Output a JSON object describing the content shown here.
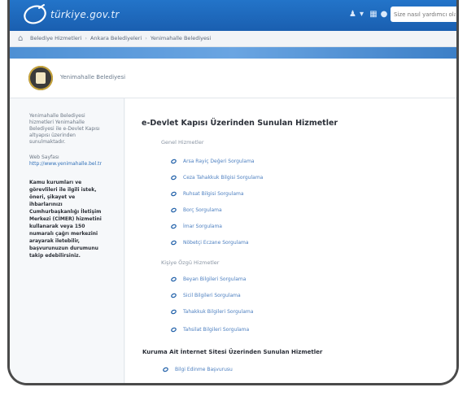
{
  "header": {
    "logo_text": "türkiye.gov.tr",
    "icons": [
      "user-icon",
      "chevron-down-icon",
      "language-icon",
      "contrast-icon"
    ],
    "search_placeholder": "Size nasıl yardımcı olabilirim?"
  },
  "breadcrumb": [
    "Belediye Hizmetleri",
    "Ankara Belediyeleri",
    "Yenimahalle Belediyesi"
  ],
  "institution": {
    "name": "Yenimahalle Belediyesi"
  },
  "sidebar": {
    "intro": "Yenimahalle Belediyesi hizmetleri Yenimahalle Belediyesi ile e-Devlet Kapısı altyapısı üzerinden sunulmaktadır.",
    "web_label": "Web Sayfası",
    "web_link": "http://www.yenimahalle.bel.tr",
    "notice": "Kamu kurumları ve görevlileri ile ilgili istek, öneri, şikayet ve ihbarlarınızı Cumhurbaşkanlığı İletişim Merkezi (CİMER) hizmetini kullanarak veya 150 numaralı çağrı merkezini arayarak iletebilir, başvurunuzun durumunu takip edebilirsiniz."
  },
  "main": {
    "title": "e-Devlet Kapısı Üzerinden Sunulan Hizmetler",
    "groups": [
      {
        "title": "Genel Hizmetler",
        "items": [
          "Arsa Rayiç Değeri Sorgulama",
          "Ceza Tahakkuk Bilgisi Sorgulama",
          "Ruhsat Bilgisi Sorgulama",
          "Borç Sorgulama",
          "İmar Sorgulama",
          "Nöbetçi Eczane Sorgulama"
        ]
      },
      {
        "title": "Kişiye Özgü Hizmetler",
        "items": [
          "Beyan Bilgileri Sorgulama",
          "Sicil Bilgileri Sorgulama",
          "Tahakkuk Bilgileri Sorgulama",
          "Tahsilat Bilgileri Sorgulama"
        ]
      }
    ],
    "section2_title": "Kuruma Ait İnternet Sitesi Üzerinden Sunulan Hizmetler",
    "section2_items": [
      "Bilgi Edinme Başvurusu"
    ]
  }
}
